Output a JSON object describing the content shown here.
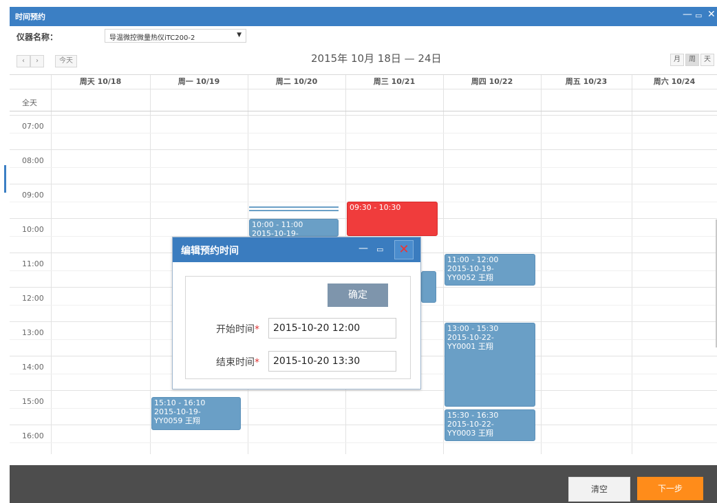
{
  "window": {
    "title": "时间预约",
    "controls": [
      "—",
      "▭",
      "✕"
    ]
  },
  "instrument": {
    "label": "仪器名称：",
    "value": "导温微控微量热仪iTC200-2"
  },
  "toolbar": {
    "prev": "‹",
    "next": "›",
    "today": "今天",
    "week_title": "2015年 10月 18日 — 24日",
    "month": "月",
    "week": "周",
    "day": "天"
  },
  "calendar": {
    "allday_label": "全天",
    "days": [
      "周天 10/18",
      "周一 10/19",
      "周二 10/20",
      "周三 10/21",
      "周四 10/22",
      "周五 10/23",
      "周六 10/24"
    ],
    "times": [
      "07:00",
      "08:00",
      "09:00",
      "10:00",
      "11:00",
      "12:00",
      "13:00",
      "14:00",
      "15:00",
      "16:00"
    ],
    "events": [
      {
        "day": "周二 10/20",
        "text": "10:00 - 11:00\n2015-10-19-"
      },
      {
        "day": "周三 10/21",
        "text": "09:30 - 10:30",
        "color": "#f03c3c"
      },
      {
        "day": "周四 10/22",
        "text": "11:00 - 12:00\n2015-10-19-\nYY0052 王翔"
      },
      {
        "day": "周四 10/22",
        "text": "13:00 - 15:30\n2015-10-22-\nYY0001 王翔"
      },
      {
        "day": "周四 10/22",
        "text": "15:30 - 16:30\n2015-10-22-\nYY0003 王翔"
      },
      {
        "day": "周一 10/19",
        "text": "15:10 - 16:10\n2015-10-19-\nYY0059 王翔"
      }
    ]
  },
  "dialog": {
    "title": "编辑预约时间",
    "ok": "确定",
    "start_label": "开始时间",
    "start_value": "2015-10-20 12:00",
    "end_label": "结束时间",
    "end_value": "2015-10-20 13:30",
    "required_mark": "*"
  },
  "footer": {
    "clear": "清空",
    "next": "下一步"
  },
  "colors": {
    "accent": "#3b7fc4",
    "event": "#6a9fc6",
    "event_conflict": "#f03c3c",
    "next_button": "#ff8c1a"
  }
}
